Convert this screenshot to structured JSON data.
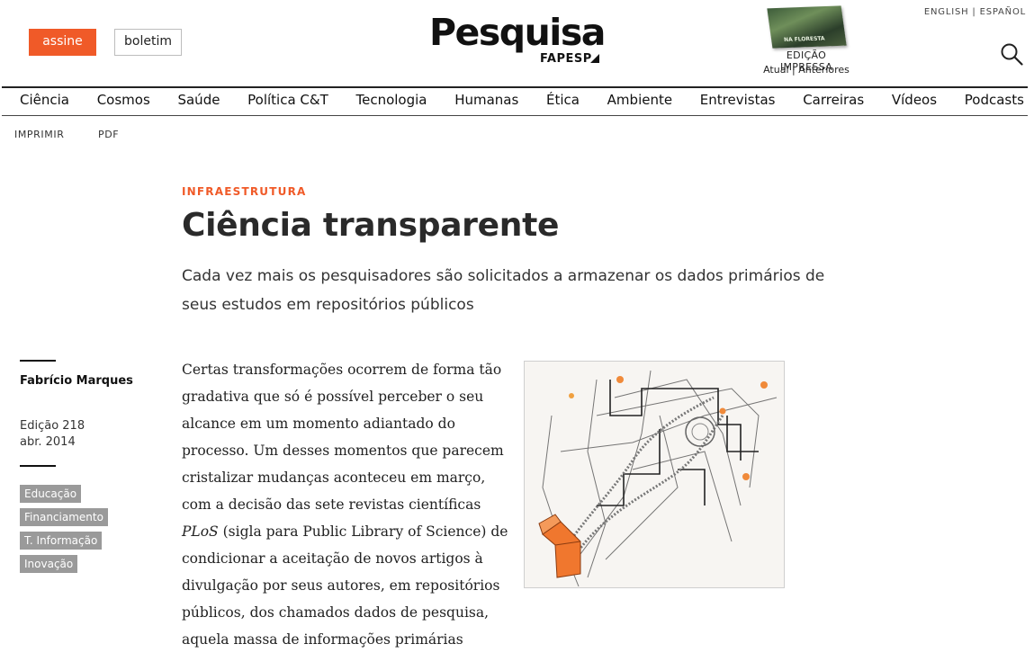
{
  "header": {
    "subscribe_label": "assine",
    "newsletter_label": "boletim",
    "logo_text": "Pesquisa",
    "logo_sub": "FAPESP",
    "cover_text": "NA FLORESTA",
    "print_edition_label": "EDIÇÃO IMPRESSA",
    "current_label": "Atual",
    "separator": "|",
    "previous_label": "Anteriores",
    "lang_english": "ENGLISH",
    "lang_spanish": "ESPAÑOL"
  },
  "nav": {
    "items": [
      "Ciência",
      "Cosmos",
      "Saúde",
      "Política C&T",
      "Tecnologia",
      "Humanas",
      "Ética",
      "Ambiente",
      "Entrevistas",
      "Carreiras",
      "Vídeos",
      "Podcasts"
    ]
  },
  "tools": {
    "print": "IMPRIMIR",
    "pdf": "PDF"
  },
  "article": {
    "section": "INFRAESTRUTURA",
    "title": "Ciência transparente",
    "dek": "Cada vez mais os pesquisadores são solicitados a armazenar os dados primários de seus estudos em repositórios públicos",
    "author": "Fabrício Marques",
    "edition": "Edição 218",
    "date": "abr. 2014",
    "tags": [
      "Educação",
      "Financiamento",
      "T. Informação",
      "Inovação"
    ],
    "body_part1": "Certas transformações ocorrem de forma tão gradativa que só é possível perceber o seu alcance em um momento adiantado do processo. Um desses momentos que parecem cristalizar mudanças aconteceu em março, com a decisão das sete revistas científicas ",
    "body_em": "PLoS",
    "body_part2": " (sigla para Public Library of Science) de condicionar a aceitação de novos artigos à divulgação por seus autores, em repositórios públicos, dos chamados dados de pesquisa, aquela massa de informações primárias"
  },
  "colors": {
    "accent": "#f05a28",
    "tag_bg": "#9a9a9a",
    "text": "#222222"
  }
}
